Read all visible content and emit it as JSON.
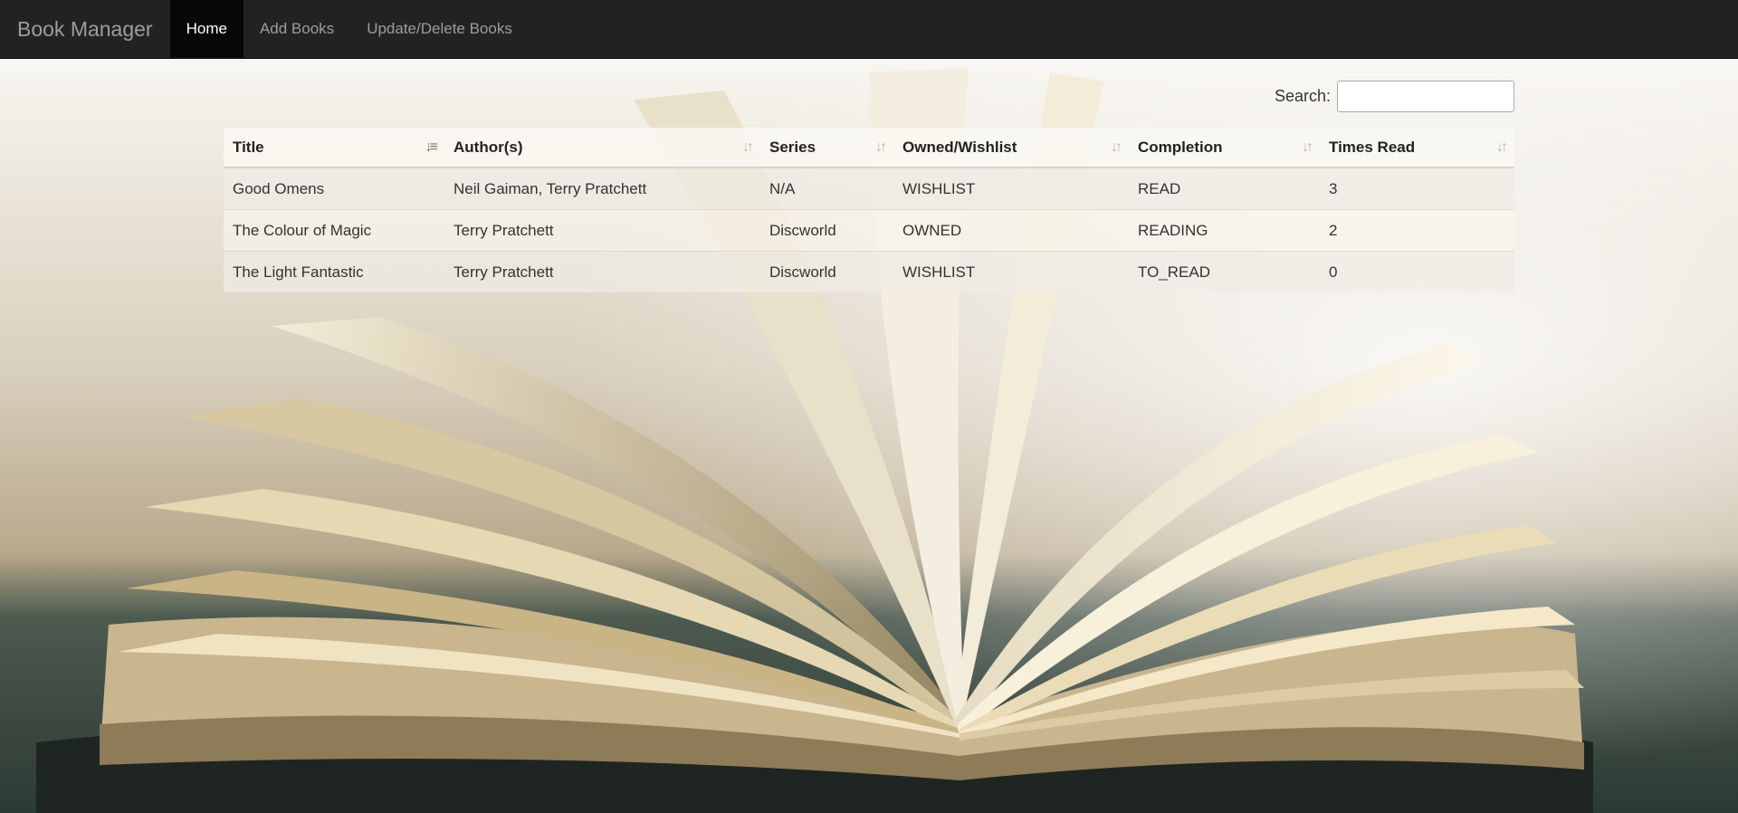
{
  "navbar": {
    "brand": "Book Manager",
    "items": [
      {
        "label": "Home",
        "active": true
      },
      {
        "label": "Add Books",
        "active": false
      },
      {
        "label": "Update/Delete Books",
        "active": false
      }
    ]
  },
  "search": {
    "label": "Search:",
    "value": ""
  },
  "table": {
    "columns": [
      {
        "label": "Title",
        "sort": "ascending",
        "sort_icon": "sort-ascending-icon"
      },
      {
        "label": "Author(s)",
        "sort": "none",
        "sort_icon": "sort-both-icon"
      },
      {
        "label": "Series",
        "sort": "none",
        "sort_icon": "sort-both-icon"
      },
      {
        "label": "Owned/Wishlist",
        "sort": "none",
        "sort_icon": "sort-both-icon"
      },
      {
        "label": "Completion",
        "sort": "none",
        "sort_icon": "sort-both-icon"
      },
      {
        "label": "Times Read",
        "sort": "none",
        "sort_icon": "sort-both-icon"
      }
    ],
    "rows": [
      [
        "Good Omens",
        "Neil Gaiman, Terry Pratchett",
        "N/A",
        "WISHLIST",
        "READ",
        "3"
      ],
      [
        "The Colour of Magic",
        "Terry Pratchett",
        "Discworld",
        "OWNED",
        "READING",
        "2"
      ],
      [
        "The Light Fantastic",
        "Terry Pratchett",
        "Discworld",
        "WISHLIST",
        "TO_READ",
        "0"
      ]
    ]
  },
  "colors": {
    "navbar_bg": "#222222",
    "navbar_active_bg": "#080808",
    "navbar_text": "#9d9d9d",
    "navbar_active_text": "#ffffff"
  }
}
